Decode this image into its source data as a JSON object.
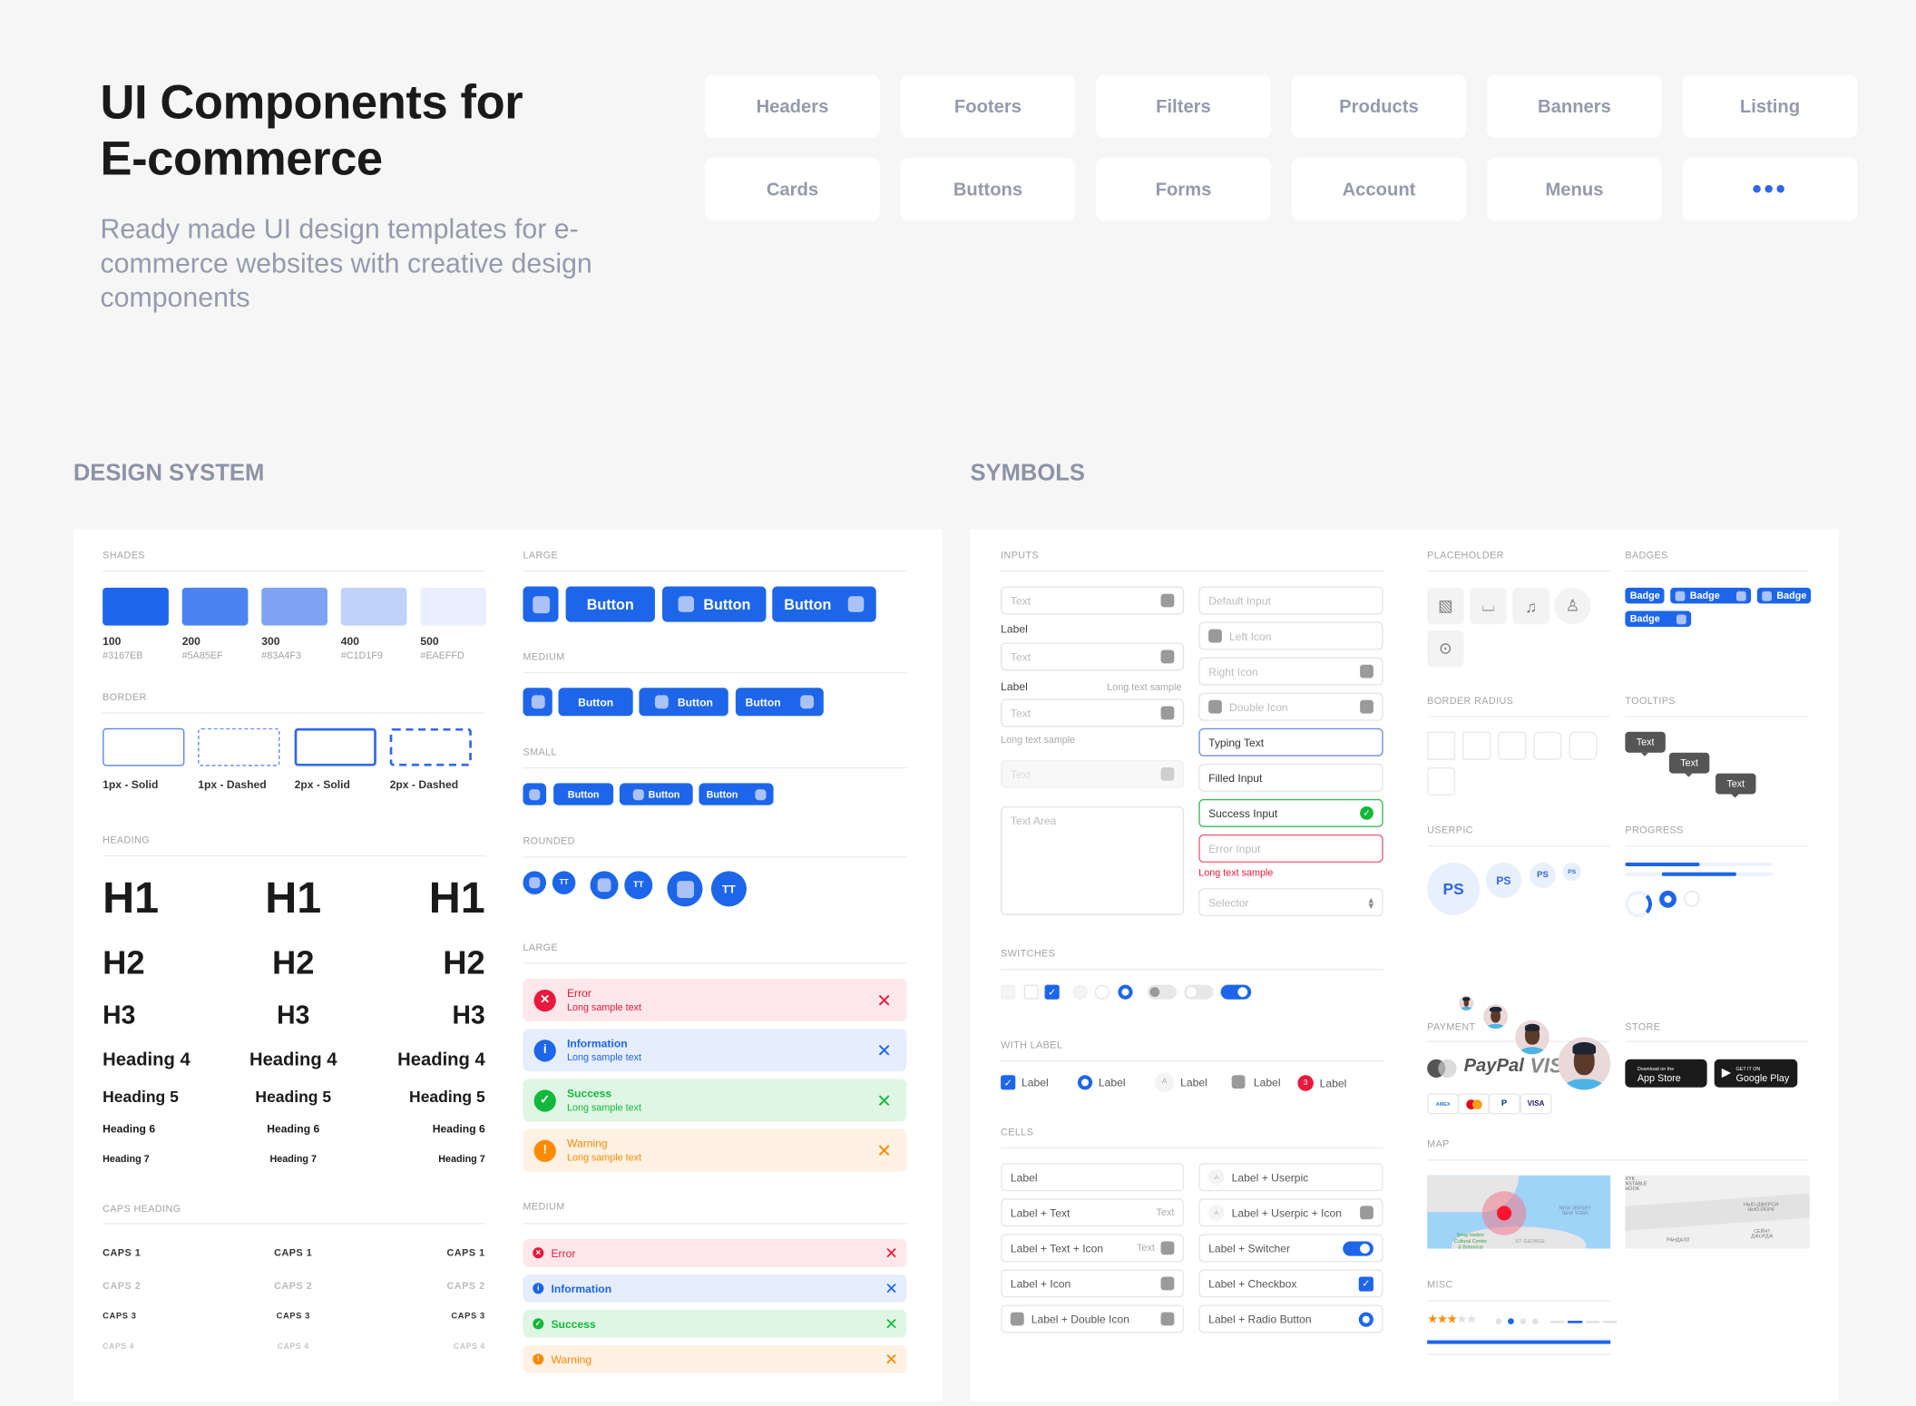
{
  "hero": {
    "title_line1": "UI Components for",
    "title_line2": "E-commerce",
    "subtitle": "Ready made UI design templates for e-commerce websites with creative design components"
  },
  "nav": {
    "items": [
      "Headers",
      "Footers",
      "Filters",
      "Products",
      "Banners",
      "Listing",
      "Cards",
      "Buttons",
      "Forms",
      "Account",
      "Menus"
    ],
    "more_label": "•••"
  },
  "sections": {
    "design_system": "DESIGN SYSTEM",
    "symbols": "SYMBOLS"
  },
  "design_system": {
    "shades_label": "SHADES",
    "shades": [
      {
        "num": "100",
        "hex": "#3167EB",
        "color": "#1d66ea"
      },
      {
        "num": "200",
        "hex": "#5A85EF",
        "color": "#4b84f0"
      },
      {
        "num": "300",
        "hex": "#83A4F3",
        "color": "#7ea3f4"
      },
      {
        "num": "400",
        "hex": "#C1D1F9",
        "color": "#bfd2fa"
      },
      {
        "num": "500",
        "hex": "#EAEFFD",
        "color": "#e9effd"
      }
    ],
    "border_label": "BORDER",
    "borders": [
      "1px - Solid",
      "1px - Dashed",
      "2px - Solid",
      "2px - Dashed"
    ],
    "heading_label": "HEADING",
    "headings": [
      "H1",
      "H2",
      "H3",
      "Heading 4",
      "Heading 5",
      "Heading 6",
      "Heading 7"
    ],
    "caps_label": "CAPS HEADING",
    "caps": [
      "CAPS 1",
      "CAPS 2",
      "CAPS 3",
      "CAPS 4"
    ],
    "btn_large_label": "LARGE",
    "btn_medium_label": "MEDIUM",
    "btn_small_label": "SMALL",
    "btn_rounded_label": "ROUNDED",
    "button_text": "Button",
    "rounded_text": "TT",
    "alert_large_label": "LARGE",
    "alert_medium_label": "MEDIUM",
    "alerts": [
      {
        "title": "Error",
        "text": "Long sample text",
        "fg": "#e8193c",
        "bg": "#fde7ea",
        "glyph": "✕"
      },
      {
        "title": "Information",
        "text": "Long sample text",
        "fg": "#1d66ea",
        "bg": "#e6eefd",
        "glyph": "i"
      },
      {
        "title": "Success",
        "text": "Long sample text",
        "fg": "#13b83a",
        "bg": "#e0f6e4",
        "glyph": "✓"
      },
      {
        "title": "Warning",
        "text": "Long sample text",
        "fg": "#ff8a00",
        "bg": "#fff1e3",
        "glyph": "!"
      }
    ],
    "close_glyph": "✕"
  },
  "symbols": {
    "inputs_label": "INPUTS",
    "text_placeholder": "Text",
    "label": "Label",
    "long_text": "Long text sample",
    "textarea_placeholder": "Text Area",
    "right_inputs": [
      "Default Input",
      "Left Icon",
      "Right Icon",
      "Double Icon",
      "Typing Text",
      "Filled Input",
      "Success Input",
      "Error Input"
    ],
    "error_hint": "Long text sample",
    "selector_placeholder": "Selector",
    "switches_label": "SWITCHES",
    "with_label_label": "WITH LABEL",
    "with_label_items": [
      "Label",
      "Label",
      "Label",
      "Label",
      "Label"
    ],
    "counter_badge": "3",
    "userpic_initial": "A",
    "cells_label": "CELLS",
    "cells_left": [
      "Label",
      "Label + Text",
      "Label + Text + Icon",
      "Label + Icon",
      "Label + Double Icon"
    ],
    "cells_right": [
      "Label + Userpic",
      "Label + Userpic + Icon",
      "Label + Switcher",
      "Label + Checkbox",
      "Label + Radio Button"
    ],
    "cell_text": "Text",
    "placeholder_label": "PLACEHOLDER",
    "badges_label": "BADGES",
    "badge_text": "Badge",
    "border_radius_label": "BORDER RADIUS",
    "tooltips_label": "TOOLTIPS",
    "tooltip_text": "Text",
    "userpic_label": "USERPIC",
    "userpic_initials": "PS",
    "progress_label": "PROGRESS",
    "progress": {
      "bar1": 0.5,
      "bar2_start": 0.25,
      "bar2_end": 0.75
    },
    "payment_label": "PAYMENT",
    "paypal": "PayPal",
    "visa": "VISA",
    "store_label": "STORE",
    "appstore_small": "Download on the",
    "appstore_big": "App Store",
    "gplay_small": "GET IT ON",
    "gplay_big": "Google Play",
    "map_label": "MAP",
    "map1_labels": [
      "NEW JERSEY",
      "NEW YORK",
      "Snug Harbor",
      "Cultural Center",
      "& Botanical",
      "ST. GEORGE"
    ],
    "map2_labels": [
      "XYK",
      "NSTABLE",
      "HOOK",
      "НЬЮ-ДЖЕРСИ",
      "НЬЮ-ЙОРК",
      "СЕЙНТ",
      "ДЖОРДЖ",
      "РАНДАЛЛ"
    ],
    "misc_label": "MISC",
    "rating": 3,
    "rating_max": 5,
    "pager_active": 2,
    "pager_count": 4
  }
}
